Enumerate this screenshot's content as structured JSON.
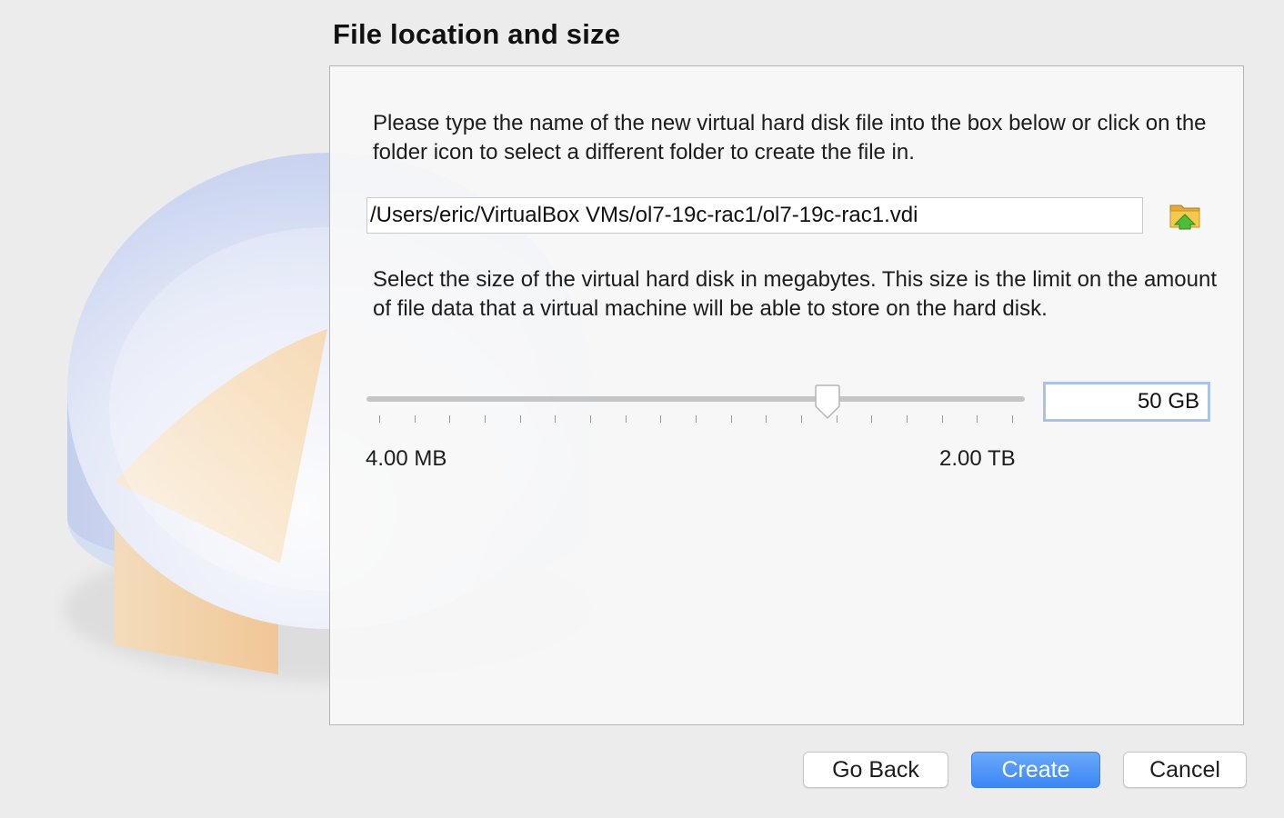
{
  "page": {
    "title": "File location and size"
  },
  "location": {
    "description": "Please type the name of the new virtual hard disk file into the box below or click on the folder icon to select a different folder to create the file in.",
    "path_value": "/Users/eric/VirtualBox VMs/ol7-19c-rac1/ol7-19c-rac1.vdi",
    "folder_icon": "folder-icon"
  },
  "size": {
    "description": "Select the size of the virtual hard disk in megabytes. This size is the limit on the amount of file data that a virtual machine will be able to store on the hard disk.",
    "value": "50 GB",
    "min_label": "4.00 MB",
    "max_label": "2.00 TB",
    "slider_position": 0.7,
    "tick_count": 19
  },
  "buttons": {
    "back": "Go Back",
    "create": "Create",
    "cancel": "Cancel"
  },
  "colors": {
    "accent": "#3b86f7",
    "background": "#ececec",
    "disk_orange": "#f5c98c",
    "disk_blue": "#c6d3ee"
  }
}
